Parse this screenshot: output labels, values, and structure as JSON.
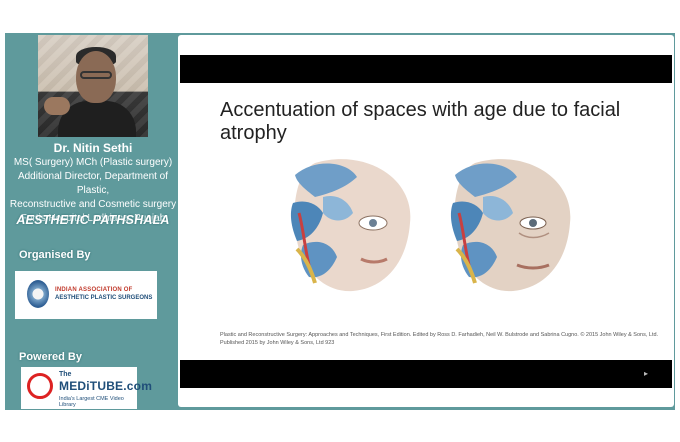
{
  "speaker": {
    "name": "Dr. Nitin Sethi",
    "credentials": [
      "MS( Surgery) MCh (Plastic surgery)",
      "Additional Director, Department of Plastic,",
      "Reconstructive and Cosmetic surgery",
      "Fortis Hospital Ludhiana, Punjab"
    ]
  },
  "brand": "AESTHETIC PATHSHALA",
  "organised_by": {
    "label": "Organised By",
    "org_line1": "INDIAN ASSOCIATION OF",
    "org_line2": "AESTHETIC PLASTIC SURGEONS"
  },
  "powered_by": {
    "label": "Powered By",
    "logo_the": "The",
    "logo_name": "MEDiTUBE.com",
    "logo_tag": "India's Largest CME Video Library"
  },
  "slide": {
    "title": "Accentuation of spaces with age due to facial atrophy",
    "caption": "Plastic and Reconstructive Surgery: Approaches and Techniques, First Edition. Edited by Ross D. Farhadieh, Neil W. Bulstrode and Sabrina Cugno. © 2015 John Wiley & Sons, Ltd. Published 2015 by John Wiley & Sons, Ltd 923"
  },
  "colors": {
    "panel_bg": "#5f9a9c",
    "bars": "#000000",
    "accent_red": "#c0392b",
    "accent_blue": "#1f4e79"
  }
}
